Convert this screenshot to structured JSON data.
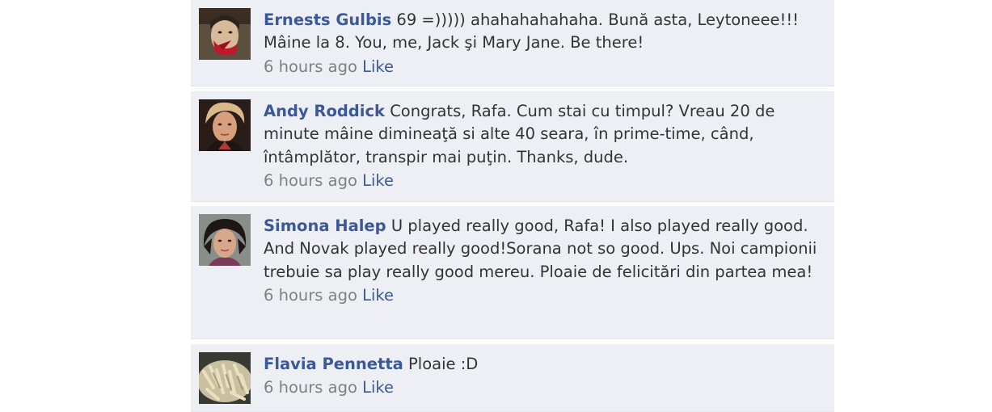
{
  "comments": [
    {
      "author": "Ernests Gulbis",
      "text": "69 =))))) ahahahahahaha. Bună asta, Leytoneee!!! Mâine la 8. You, me, Jack şi Mary Jane. Be there!",
      "time": "6 hours ago",
      "like_label": "Like"
    },
    {
      "author": "Andy Roddick",
      "text": "Congrats, Rafa. Cum stai cu timpul? Vreau 20 de minute mâine dimineaţă si alte 40 seara, în prime-time, când, întâmplător, transpir mai puţin. Thanks, dude.",
      "time": "6 hours ago",
      "like_label": "Like"
    },
    {
      "author": "Simona Halep",
      "text": "U played really good, Rafa! I also played really good. And Novak played really good!Sorana not so good. Ups. Noi campionii trebuie sa play really good mereu. Ploaie de felicitări din partea mea!",
      "time": "6 hours ago",
      "like_label": "Like"
    },
    {
      "author": "Flavia Pennetta",
      "text": "Ploaie :D",
      "time": "6 hours ago",
      "like_label": "Like"
    }
  ],
  "colors": {
    "background": "#edeff4",
    "link": "#3b5998",
    "text": "#333333",
    "meta": "#808080"
  }
}
